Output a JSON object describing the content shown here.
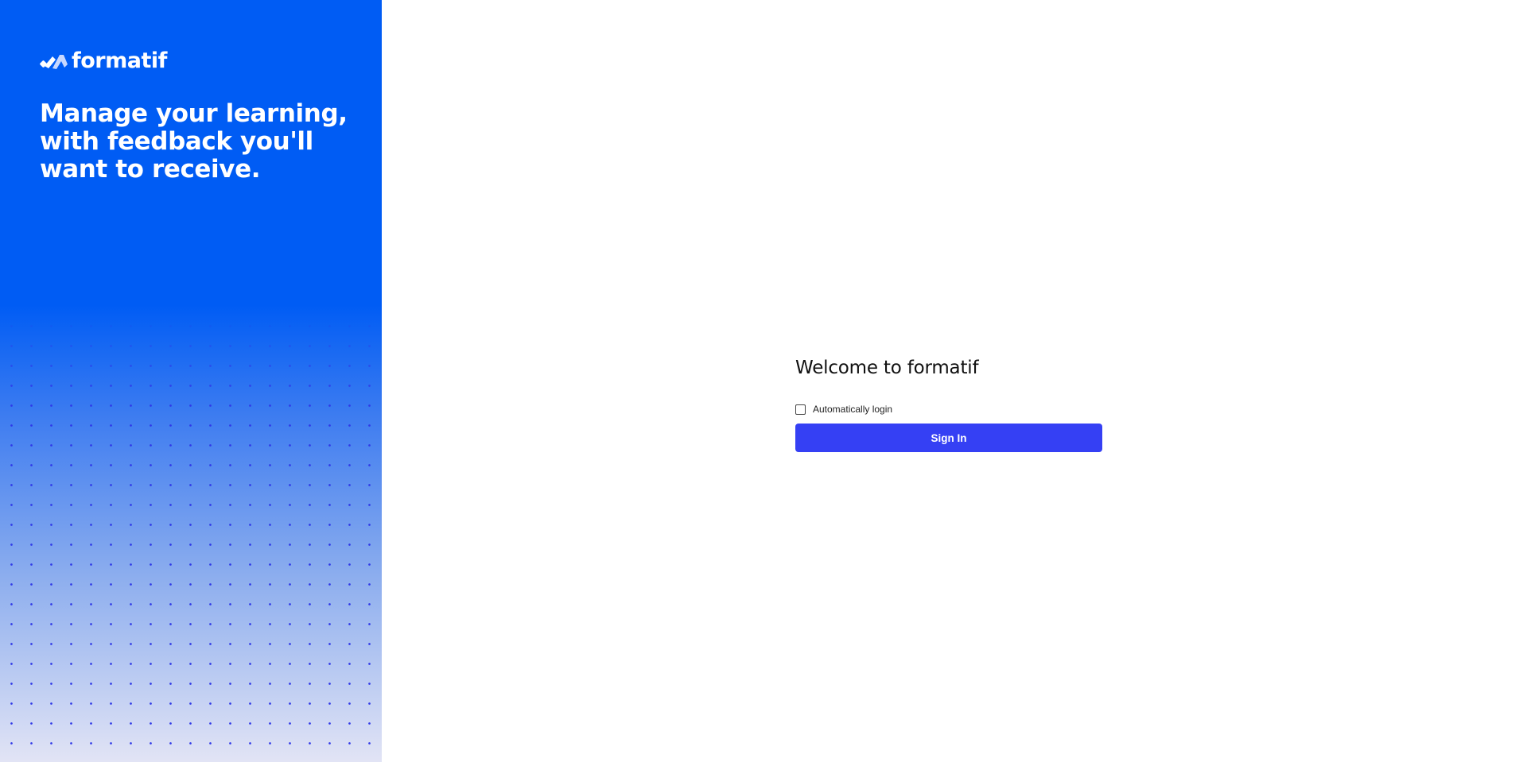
{
  "brand": {
    "logo_text": "formatif",
    "logo_icon": "formatif-logo-icon",
    "tagline": "Manage your learning, with feedback you'll want to receive.",
    "colors": {
      "panel_blue": "#005cf4",
      "dot_color": "#2f38e8"
    }
  },
  "login": {
    "title": "Welcome to formatif",
    "auto_login_label": "Automatically login",
    "auto_login_checked": false,
    "sign_in_label": "Sign In",
    "colors": {
      "button": "#3540f4"
    }
  }
}
